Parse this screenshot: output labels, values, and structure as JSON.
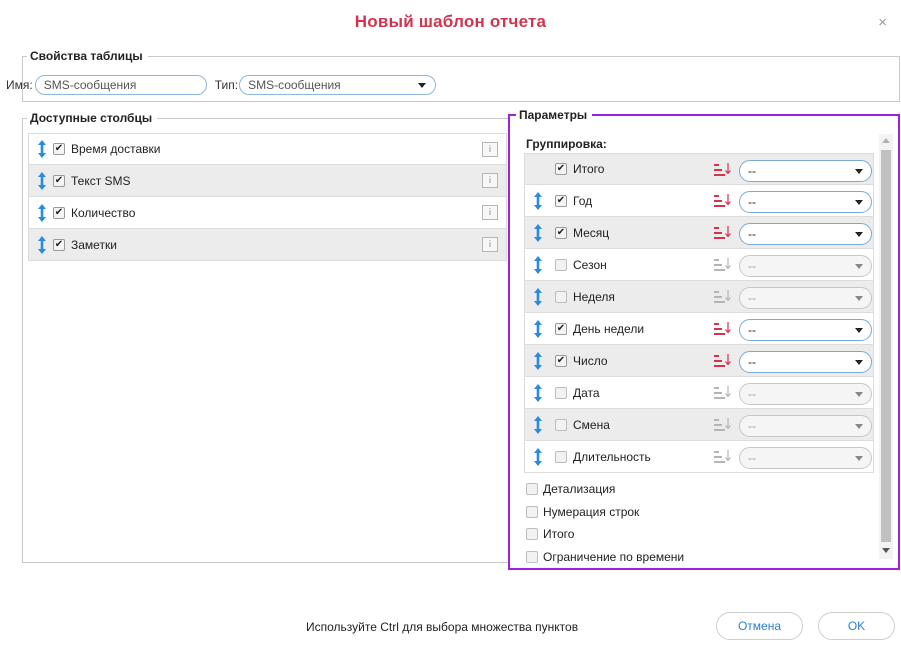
{
  "dialog": {
    "title": "Новый шаблон отчета",
    "close_glyph": "×"
  },
  "table_props": {
    "legend": "Свойства таблицы",
    "name_label": "Имя:",
    "name_value": "SMS-сообщения",
    "type_label": "Тип:",
    "type_value": "SMS-сообщения"
  },
  "available_columns": {
    "legend": "Доступные столбцы",
    "items": [
      {
        "label": "Время доставки",
        "checked": true
      },
      {
        "label": "Текст SMS",
        "checked": true
      },
      {
        "label": "Количество",
        "checked": true
      },
      {
        "label": "Заметки",
        "checked": true
      }
    ]
  },
  "params": {
    "legend": "Параметры",
    "grouping_title": "Группировка:",
    "rows": [
      {
        "label": "Итого",
        "checked": true,
        "value": "--",
        "draggable": false
      },
      {
        "label": "Год",
        "checked": true,
        "value": "--",
        "draggable": true
      },
      {
        "label": "Месяц",
        "checked": true,
        "value": "--",
        "draggable": true
      },
      {
        "label": "Сезон",
        "checked": false,
        "value": "--",
        "draggable": true
      },
      {
        "label": "Неделя",
        "checked": false,
        "value": "--",
        "draggable": true
      },
      {
        "label": "День недели",
        "checked": true,
        "value": "--",
        "draggable": true
      },
      {
        "label": "Число",
        "checked": true,
        "value": "--",
        "draggable": true
      },
      {
        "label": "Дата",
        "checked": false,
        "value": "--",
        "draggable": true
      },
      {
        "label": "Смена",
        "checked": false,
        "value": "--",
        "draggable": true
      },
      {
        "label": "Длительность",
        "checked": false,
        "value": "--",
        "draggable": true
      }
    ],
    "options": [
      {
        "label": "Детализация",
        "checked": false
      },
      {
        "label": "Нумерация строк",
        "checked": false
      },
      {
        "label": "Итого",
        "checked": false
      },
      {
        "label": "Ограничение по времени",
        "checked": false
      }
    ]
  },
  "footer": {
    "hint": "Используйте Ctrl для выбора множества пунктов",
    "cancel_label": "Отмена",
    "ok_label": "OK"
  },
  "colors": {
    "title": "#d0344f",
    "accent_blue": "#2a7fd4",
    "sort_active": "#d0344f",
    "highlight_border": "#a01fe0"
  }
}
